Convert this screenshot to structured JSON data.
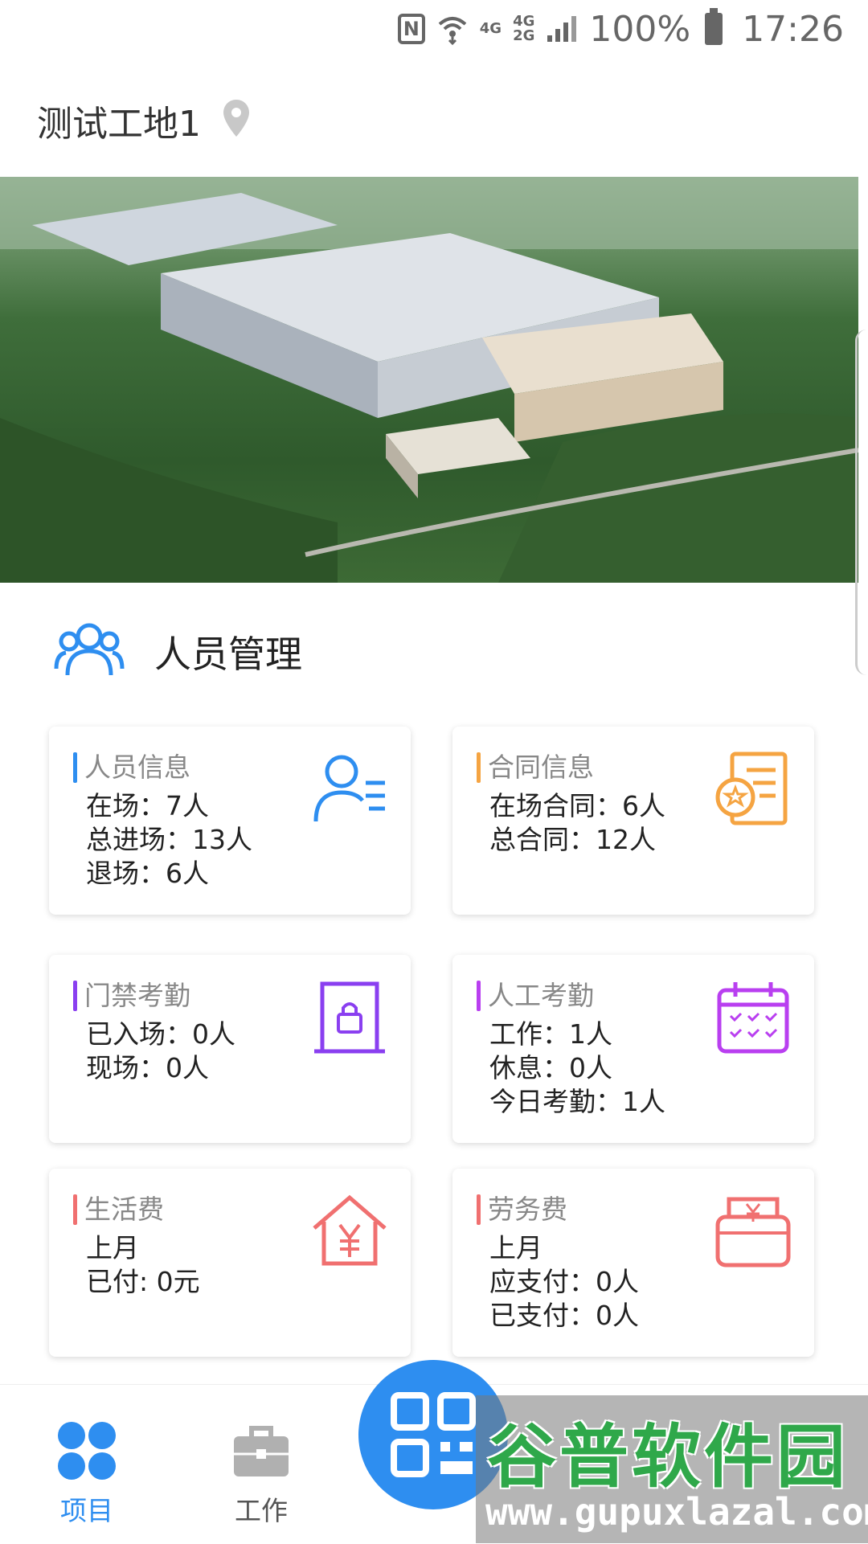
{
  "status": {
    "battery": "100%",
    "time": "17:26",
    "net1": "4G",
    "net2a": "4G",
    "net2b": "2G"
  },
  "header": {
    "site_name": "测试工地1"
  },
  "section": {
    "title": "人员管理"
  },
  "cards": [
    {
      "title": "人员信息",
      "lines": [
        "在场：7人",
        "总进场：13人",
        "退场：6人"
      ],
      "accent": "#2e8ef0",
      "icon": "person-list-icon"
    },
    {
      "title": "合同信息",
      "lines": [
        "在场合同：6人",
        "总合同：12人"
      ],
      "accent": "#f5a442",
      "icon": "contract-icon"
    },
    {
      "title": "门禁考勤",
      "lines": [
        "已入场：0人",
        "现场：0人"
      ],
      "accent": "#8a3ff0",
      "icon": "door-lock-icon"
    },
    {
      "title": "人工考勤",
      "lines": [
        "工作：1人",
        "休息：0人",
        "今日考勤：1人"
      ],
      "accent": "#b93ff0",
      "icon": "calendar-check-icon"
    },
    {
      "title": "生活费",
      "lines": [
        "上月",
        "已付: 0元"
      ],
      "accent": "#f07070",
      "icon": "house-yuan-icon"
    },
    {
      "title": "劳务费",
      "lines": [
        "上月",
        "应支付：0人",
        "已支付：0人"
      ],
      "accent": "#f07070",
      "icon": "wallet-yuan-icon"
    }
  ],
  "nav": {
    "project": "项目",
    "work": "工作"
  },
  "watermark": {
    "title": "谷普软件园",
    "url": "www.gupuxlazal.com"
  }
}
